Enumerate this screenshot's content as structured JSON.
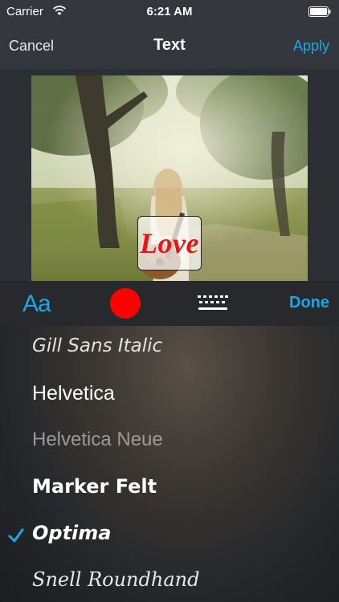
{
  "status_bar": {
    "carrier": "Carrier",
    "time": "6:21 AM"
  },
  "nav": {
    "cancel_label": "Cancel",
    "title": "Text",
    "apply_label": "Apply"
  },
  "canvas": {
    "text_content": "Love",
    "text_color": "#e4161b"
  },
  "toolbar": {
    "font_tool_label": "Aa",
    "selected_color": "#ff0000",
    "done_label": "Done"
  },
  "font_list": {
    "items": [
      {
        "label": "Gill Sans Italic",
        "selected": false
      },
      {
        "label": "Helvetica",
        "selected": false
      },
      {
        "label": "Helvetica Neue",
        "selected": false
      },
      {
        "label": "Marker Felt",
        "selected": false
      },
      {
        "label": "Optima",
        "selected": true
      },
      {
        "label": "Snell Roundhand",
        "selected": false
      }
    ]
  },
  "colors": {
    "accent": "#1ba6e6",
    "bar_background": "#34383e"
  }
}
